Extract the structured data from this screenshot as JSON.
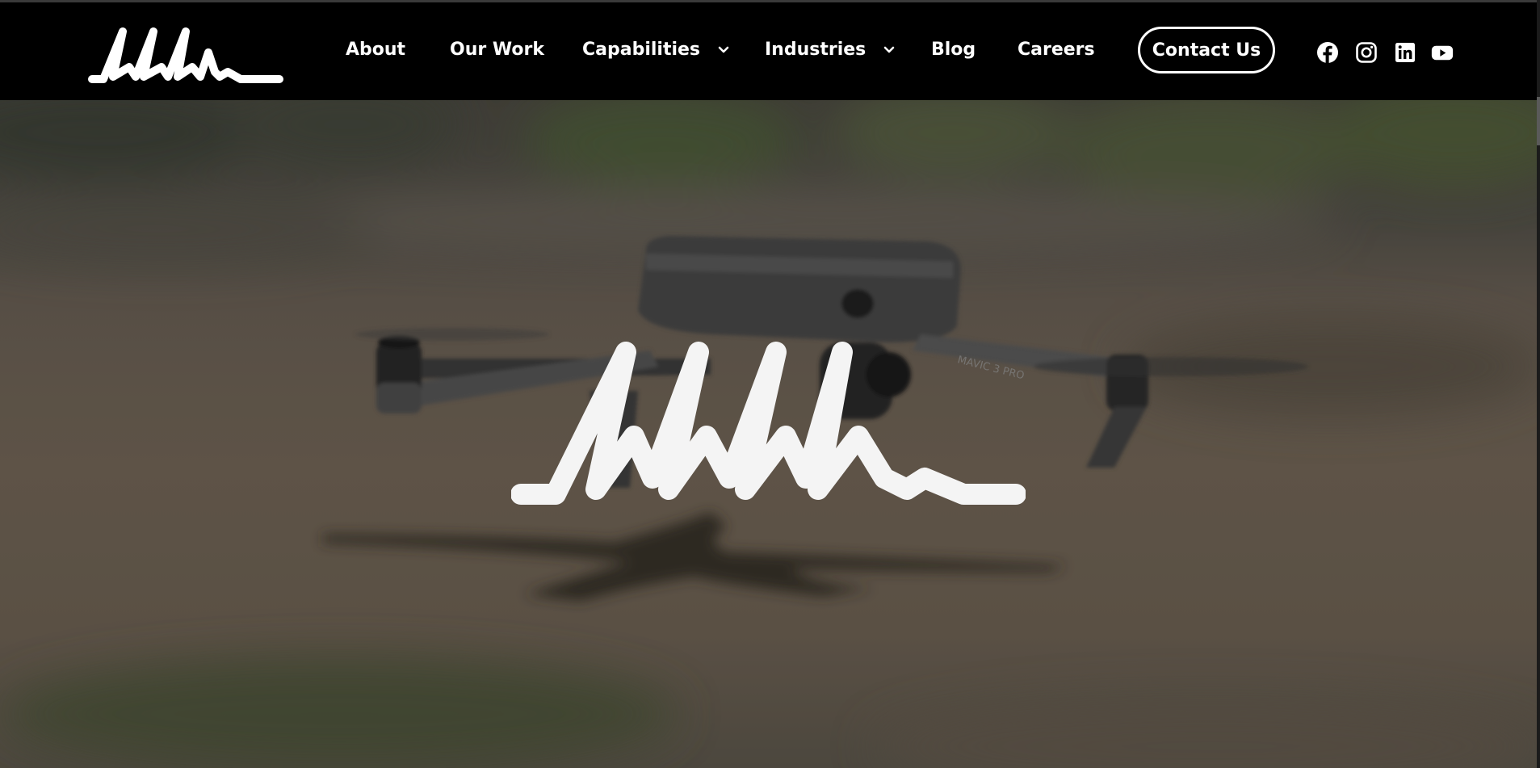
{
  "brand": {
    "logo_name": "MMM wave logo"
  },
  "nav": {
    "links": [
      {
        "label": "About"
      },
      {
        "label": "Our Work"
      },
      {
        "label": "Capabilities",
        "has_dropdown": true
      },
      {
        "label": "Industries",
        "has_dropdown": true
      },
      {
        "label": "Blog"
      },
      {
        "label": "Careers"
      }
    ],
    "cta_label": "Contact Us",
    "social": [
      "facebook-icon",
      "instagram-icon",
      "linkedin-icon",
      "youtube-icon"
    ]
  },
  "hero": {
    "background": "blurred drone hovering over sandy ground",
    "drone_label": "MAVIC 3 PRO"
  },
  "colors": {
    "nav_bg": "#000000",
    "nav_text": "#ffffff",
    "hero_overlay": "#5d564d"
  }
}
